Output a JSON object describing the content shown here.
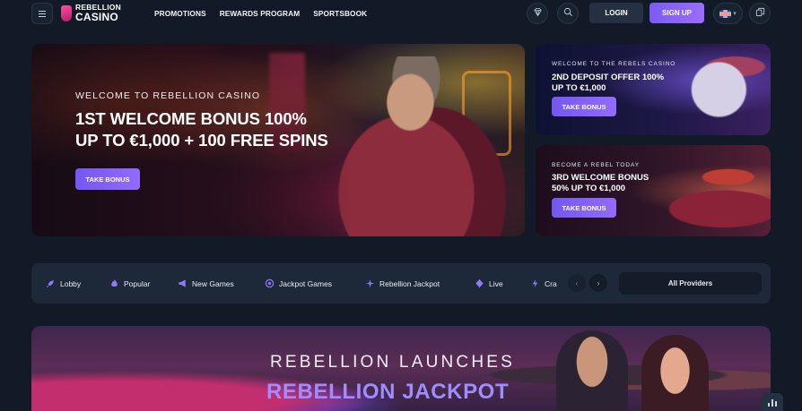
{
  "header": {
    "logo_line1": "REBELLION",
    "logo_line2": "CASINO",
    "nav": [
      "PROMOTIONS",
      "REWARDS PROGRAM",
      "SPORTSBOOK"
    ],
    "login_label": "LOGIN",
    "signup_label": "SIGN UP",
    "icons": [
      "menu-icon",
      "gem-icon",
      "search-icon",
      "uk-flag-icon",
      "chevron-down-icon",
      "copy-icon"
    ]
  },
  "hero": {
    "eyebrow": "WELCOME TO REBELLION CASINO",
    "headline_line1": "1ST WELCOME BONUS 100%",
    "headline_line2": "UP TO €1,000 + 100 FREE SPINS",
    "button_label": "TAKE BONUS"
  },
  "promos": [
    {
      "eyebrow": "WELCOME TO THE REBELS CASINO",
      "title_line1": "2ND DEPOSIT OFFER 100%",
      "title_line2": "UP TO €1,000",
      "button_label": "TAKE BONUS"
    },
    {
      "eyebrow": "BECOME A REBEL TODAY",
      "title_line1": "3RD WELCOME BONUS",
      "title_line2": "50% UP TO €1,000",
      "button_label": "TAKE BONUS"
    }
  ],
  "categories": [
    {
      "label": "Lobby",
      "icon": "rocket-icon"
    },
    {
      "label": "Popular",
      "icon": "flame-icon"
    },
    {
      "label": "New Games",
      "icon": "megaphone-icon"
    },
    {
      "label": "Jackpot Games",
      "icon": "jackpot-icon"
    },
    {
      "label": "Rebellion Jackpot",
      "icon": "sparkle-icon"
    },
    {
      "label": "Live",
      "icon": "live-icon"
    },
    {
      "label": "Cra",
      "icon": "bolt-icon"
    }
  ],
  "providers_label": "All Providers",
  "banner": {
    "line1": "REBELLION LAUNCHES",
    "line2": "REBELLION JACKPOT"
  },
  "colors": {
    "background": "#111a26",
    "accent": "#7c5cf6",
    "panel": "#1d2938"
  }
}
